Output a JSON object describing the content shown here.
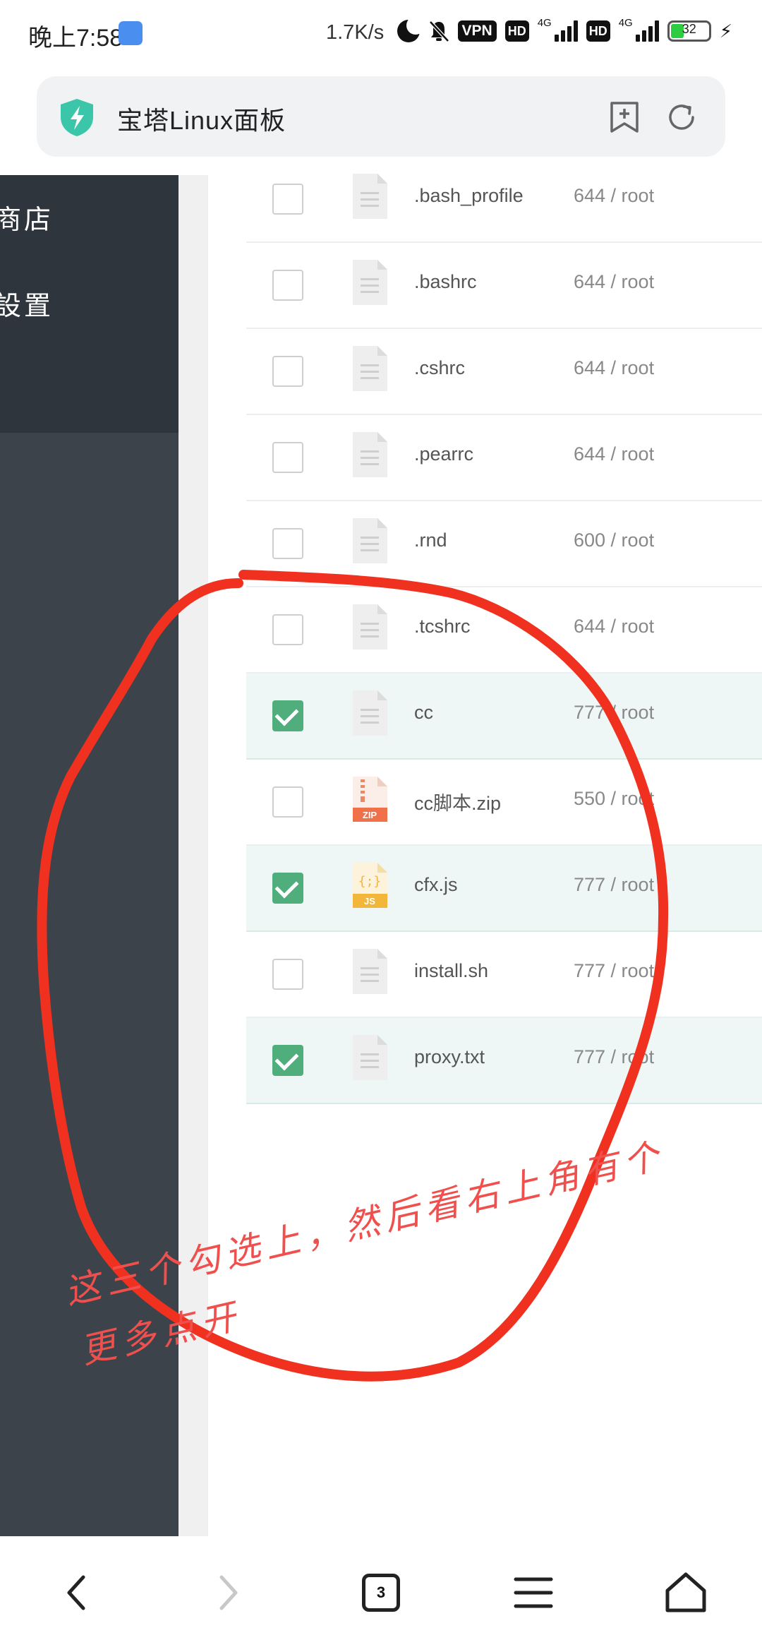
{
  "status_bar": {
    "time": "晚上7:58",
    "net_speed": "1.7K/s",
    "vpn": "VPN",
    "hd1": "HD",
    "net1": "4G",
    "hd2": "HD",
    "net2": "4G",
    "battery": "32"
  },
  "browser": {
    "title": "宝塔Linux面板"
  },
  "sidebar": {
    "items": [
      {
        "label": "商店"
      },
      {
        "label": "設置"
      }
    ]
  },
  "files": [
    {
      "name": ".bash_profile",
      "perm": "644 / root",
      "type": "file",
      "checked": false
    },
    {
      "name": ".bashrc",
      "perm": "644 / root",
      "type": "file",
      "checked": false
    },
    {
      "name": ".cshrc",
      "perm": "644 / root",
      "type": "file",
      "checked": false
    },
    {
      "name": ".pearrc",
      "perm": "644 / root",
      "type": "file",
      "checked": false
    },
    {
      "name": ".rnd",
      "perm": "600 / root",
      "type": "file",
      "checked": false
    },
    {
      "name": ".tcshrc",
      "perm": "644 / root",
      "type": "file",
      "checked": false
    },
    {
      "name": "cc",
      "perm": "777 / root",
      "type": "file",
      "checked": true
    },
    {
      "name": "cc脚本.zip",
      "perm": "550 / root",
      "type": "zip",
      "checked": false
    },
    {
      "name": "cfx.js",
      "perm": "777 / root",
      "type": "js",
      "checked": true
    },
    {
      "name": "install.sh",
      "perm": "777 / root",
      "type": "file",
      "checked": false
    },
    {
      "name": "proxy.txt",
      "perm": "777 / root",
      "type": "file",
      "checked": true
    }
  ],
  "annotation": {
    "line1": "这三个勾选上，然后看右上角有个",
    "line2": "更多点开",
    "color": "#f0311f"
  },
  "bottom_nav": {
    "tabs_count": "3"
  }
}
